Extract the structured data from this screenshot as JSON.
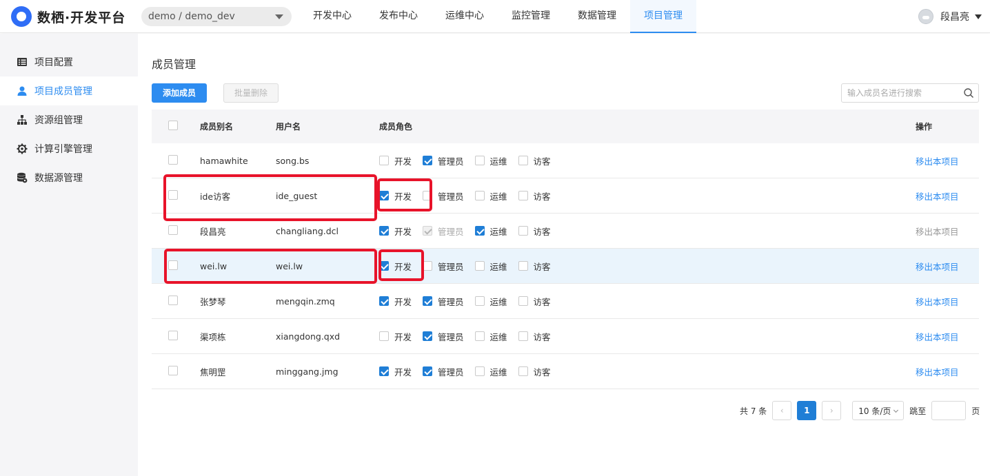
{
  "header": {
    "logo_text": "数栖·开发平台",
    "project": "demo / demo_dev",
    "nav": [
      "开发中心",
      "发布中心",
      "运维中心",
      "监控管理",
      "数据管理",
      "项目管理"
    ],
    "active_nav": "项目管理",
    "user": "段昌亮"
  },
  "sidebar": {
    "items": [
      {
        "label": "项目配置",
        "icon": "list-icon",
        "active": false
      },
      {
        "label": "项目成员管理",
        "icon": "user-icon",
        "active": true
      },
      {
        "label": "资源组管理",
        "icon": "sitemap-icon",
        "active": false
      },
      {
        "label": "计算引擎管理",
        "icon": "gear-icon",
        "active": false
      },
      {
        "label": "数据源管理",
        "icon": "database-icon",
        "active": false
      }
    ]
  },
  "main": {
    "title": "成员管理",
    "add_button": "添加成员",
    "batch_delete_button": "批量删除",
    "search_placeholder": "输入成员名进行搜索"
  },
  "table": {
    "columns": [
      "成员别名",
      "用户名",
      "成员角色",
      "操作"
    ],
    "role_names": [
      "开发",
      "管理员",
      "运维",
      "访客"
    ],
    "rows": [
      {
        "alias": "hamawhite",
        "username": "song.bs",
        "roles": [
          false,
          true,
          false,
          false
        ],
        "admin_disabled": false,
        "op": "移出本项目",
        "op_disabled": false,
        "highlight": false
      },
      {
        "alias": "ide访客",
        "username": "ide_guest",
        "roles": [
          true,
          false,
          false,
          false
        ],
        "admin_disabled": false,
        "op": "移出本项目",
        "op_disabled": false,
        "highlight": false
      },
      {
        "alias": "段昌亮",
        "username": "changliang.dcl",
        "roles": [
          true,
          true,
          true,
          false
        ],
        "admin_disabled": true,
        "op": "移出本项目",
        "op_disabled": true,
        "highlight": false
      },
      {
        "alias": "wei.lw",
        "username": "wei.lw",
        "roles": [
          true,
          false,
          false,
          false
        ],
        "admin_disabled": false,
        "op": "移出本项目",
        "op_disabled": false,
        "highlight": true
      },
      {
        "alias": "张梦琴",
        "username": "mengqin.zmq",
        "roles": [
          true,
          true,
          false,
          false
        ],
        "admin_disabled": false,
        "op": "移出本项目",
        "op_disabled": false,
        "highlight": false
      },
      {
        "alias": "渠项栋",
        "username": "xiangdong.qxd",
        "roles": [
          false,
          true,
          false,
          false
        ],
        "admin_disabled": false,
        "op": "移出本项目",
        "op_disabled": false,
        "highlight": false
      },
      {
        "alias": "焦明罡",
        "username": "minggang.jmg",
        "roles": [
          true,
          true,
          false,
          false
        ],
        "admin_disabled": false,
        "op": "移出本项目",
        "op_disabled": false,
        "highlight": false
      }
    ]
  },
  "pagination": {
    "total": "共 7 条",
    "current": "1",
    "page_size": "10 条/页",
    "jump_label": "跳至",
    "page_suffix": "页"
  },
  "colors": {
    "accent": "#2d8cf0",
    "annotation": "#e8132a",
    "highlight_row": "#eaf4fc"
  }
}
